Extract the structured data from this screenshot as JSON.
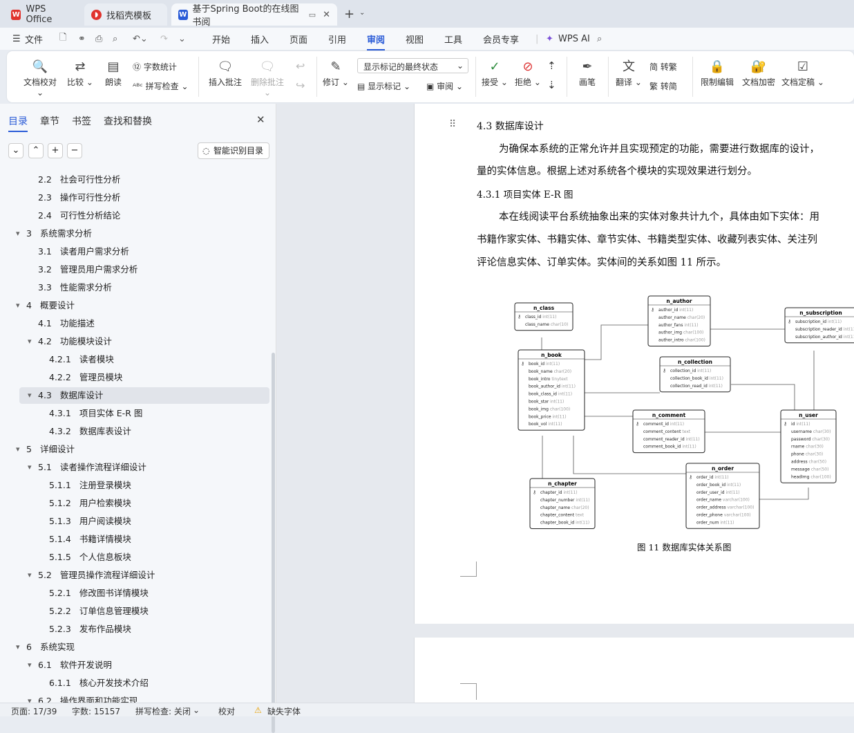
{
  "tabs": [
    {
      "label": "WPS Office"
    },
    {
      "label": "找稻壳模板"
    },
    {
      "label": "基于Spring Boot的在线图书阅"
    }
  ],
  "menu": {
    "file": "文件",
    "items": [
      "开始",
      "插入",
      "页面",
      "引用",
      "审阅",
      "视图",
      "工具",
      "会员专享"
    ],
    "ai": "WPS AI"
  },
  "ribbon": {
    "proof": "文档校对",
    "compare": "比较",
    "read": "朗读",
    "wordcount": "字数统计",
    "spell": "拼写检查",
    "insert_comment": "插入批注",
    "delete_comment": "删除批注",
    "revise": "修订",
    "markup_state": "显示标记的最终状态",
    "show_markup": "显示标记",
    "review": "审阅",
    "accept": "接受",
    "reject": "拒绝",
    "ink": "画笔",
    "translate": "翻译",
    "trad": "转繁",
    "simp": "转简",
    "restrict": "限制编辑",
    "encrypt": "文档加密",
    "finalize": "文档定稿"
  },
  "sidebar": {
    "tabs": [
      "目录",
      "章节",
      "书签",
      "查找和替换"
    ],
    "smart": "智能识别目录",
    "toc": [
      {
        "n": "2.2",
        "t": "社会可行性分析"
      },
      {
        "n": "2.3",
        "t": "操作可行性分析"
      },
      {
        "n": "2.4",
        "t": "可行性分析结论"
      },
      {
        "n": "3",
        "t": "系统需求分析"
      },
      {
        "n": "3.1",
        "t": "读者用户需求分析"
      },
      {
        "n": "3.2",
        "t": "管理员用户需求分析"
      },
      {
        "n": "3.3",
        "t": "性能需求分析"
      },
      {
        "n": "4",
        "t": "概要设计"
      },
      {
        "n": "4.1",
        "t": "功能描述"
      },
      {
        "n": "4.2",
        "t": "功能模块设计"
      },
      {
        "n": "4.2.1",
        "t": "读者模块"
      },
      {
        "n": "4.2.2",
        "t": "管理员模块"
      },
      {
        "n": "4.3",
        "t": "数据库设计"
      },
      {
        "n": "4.3.1",
        "t": "项目实体 E-R 图"
      },
      {
        "n": "4.3.2",
        "t": "数据库表设计"
      },
      {
        "n": "5",
        "t": "详细设计"
      },
      {
        "n": "5.1",
        "t": "读者操作流程详细设计"
      },
      {
        "n": "5.1.1",
        "t": "注册登录模块"
      },
      {
        "n": "5.1.2",
        "t": "用户检索模块"
      },
      {
        "n": "5.1.3",
        "t": "用户阅读模块"
      },
      {
        "n": "5.1.4",
        "t": "书籍详情模块"
      },
      {
        "n": "5.1.5",
        "t": "个人信息板块"
      },
      {
        "n": "5.2",
        "t": "管理员操作流程详细设计"
      },
      {
        "n": "5.2.1",
        "t": "修改图书详情模块"
      },
      {
        "n": "5.2.2",
        "t": "订单信息管理模块"
      },
      {
        "n": "5.2.3",
        "t": "发布作品模块"
      },
      {
        "n": "6",
        "t": "系统实现"
      },
      {
        "n": "6.1",
        "t": "软件开发说明"
      },
      {
        "n": "6.1.1",
        "t": "核心开发技术介绍"
      },
      {
        "n": "6.2",
        "t": "操作界面和功能实现"
      }
    ]
  },
  "doc": {
    "h43": "4.3   数据库设计",
    "p1a": "为确保本系统的正常允许并且实现预定的功能，需要进行数据库的设计，",
    "p1b": "量的实体信息。根据上述对系统各个模块的实现效果进行划分。",
    "h431": "4.3.1   项目实体 E-R 图",
    "p2a": "本在线阅读平台系统抽象出来的实体对象共计九个，具体由如下实体：用",
    "p2b": "书籍作家实体、书籍实体、章节实体、书籍类型实体、收藏列表实体、关注列",
    "p2c": "评论信息实体、订单实体。实体间的关系如图 11 所示。",
    "caption": "图 11  数据库实体关系图"
  },
  "er": [
    {
      "name": "n_class",
      "fields": [
        [
          "class_id",
          "int(11)"
        ],
        [
          "class_name",
          "char(10)"
        ]
      ]
    },
    {
      "name": "n_author",
      "fields": [
        [
          "author_id",
          "int(11)"
        ],
        [
          "author_name",
          "char(20)"
        ],
        [
          "author_fans",
          "int(11)"
        ],
        [
          "author_img",
          "char(100)"
        ],
        [
          "author_intro",
          "char(100)"
        ]
      ]
    },
    {
      "name": "n_subscription",
      "fields": [
        [
          "subscription_id",
          "int(11)"
        ],
        [
          "subscription_reader_id",
          "int(11)"
        ],
        [
          "subscription_author_id",
          "int(11)"
        ]
      ]
    },
    {
      "name": "n_book",
      "fields": [
        [
          "book_id",
          "int(11)"
        ],
        [
          "book_name",
          "char(20)"
        ],
        [
          "book_intro",
          "tinytext"
        ],
        [
          "book_author_id",
          "int(11)"
        ],
        [
          "book_class_id",
          "int(11)"
        ],
        [
          "book_star",
          "int(11)"
        ],
        [
          "book_img",
          "char(100)"
        ],
        [
          "book_price",
          "int(11)"
        ],
        [
          "book_vol",
          "int(11)"
        ]
      ]
    },
    {
      "name": "n_collection",
      "fields": [
        [
          "collection_id",
          "int(11)"
        ],
        [
          "collection_book_id",
          "int(11)"
        ],
        [
          "collection_read_id",
          "int(11)"
        ]
      ]
    },
    {
      "name": "n_comment",
      "fields": [
        [
          "comment_id",
          "int(11)"
        ],
        [
          "comment_content",
          "text"
        ],
        [
          "comment_reader_id",
          "int(11)"
        ],
        [
          "comment_book_id",
          "int(11)"
        ]
      ]
    },
    {
      "name": "n_user",
      "fields": [
        [
          "id",
          "int(11)"
        ],
        [
          "username",
          "char(30)"
        ],
        [
          "password",
          "char(30)"
        ],
        [
          "rname",
          "char(30)"
        ],
        [
          "phone",
          "char(30)"
        ],
        [
          "address",
          "char(50)"
        ],
        [
          "message",
          "char(50)"
        ],
        [
          "headImg",
          "char(100)"
        ]
      ]
    },
    {
      "name": "n_order",
      "fields": [
        [
          "order_id",
          "int(11)"
        ],
        [
          "order_book_id",
          "int(11)"
        ],
        [
          "order_user_id",
          "int(11)"
        ],
        [
          "order_name",
          "varchar(100)"
        ],
        [
          "order_address",
          "varchar(100)"
        ],
        [
          "order_phone",
          "varchar(100)"
        ],
        [
          "order_num",
          "int(11)"
        ]
      ]
    },
    {
      "name": "n_chapter",
      "fields": [
        [
          "chapter_id",
          "int(11)"
        ],
        [
          "chapter_number",
          "int(11)"
        ],
        [
          "chapter_name",
          "char(20)"
        ],
        [
          "chapter_content",
          "text"
        ],
        [
          "chapter_book_id",
          "int(11)"
        ]
      ]
    }
  ],
  "status": {
    "page": "页面: 17/39",
    "words": "字数: 15157",
    "spell": "拼写检查: 关闭",
    "proof": "校对",
    "font": "缺失字体"
  }
}
